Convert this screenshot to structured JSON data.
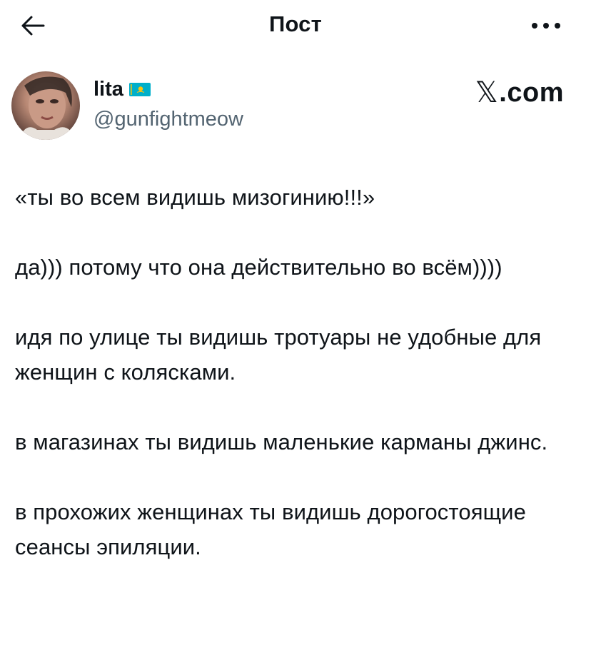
{
  "topbar": {
    "title": "Пост"
  },
  "author": {
    "display_name": "lita",
    "handle": "@gunfightmeow"
  },
  "watermark": {
    "brand_text": ".com"
  },
  "post": {
    "paragraphs": [
      "«ты во всем видишь мизогинию!!!»",
      "да))) потому что она действительно во всём))))",
      "идя по улице ты видишь тротуары не удобные для женщин с колясками.",
      "в магазинах ты видишь маленькие карманы джинс.",
      "в прохожих женщинах ты видишь дорогостоящие сеансы эпиляции."
    ]
  },
  "icons": {
    "back": "arrow-left-icon",
    "more": "more-horizontal-icon",
    "flag": "kazakhstan-flag-icon",
    "brand": "x-logo-icon"
  },
  "colors": {
    "text": "#0f1419",
    "secondary_text": "#536471",
    "flag_blue": "#00AFCA",
    "flag_gold": "#FEC50C"
  }
}
